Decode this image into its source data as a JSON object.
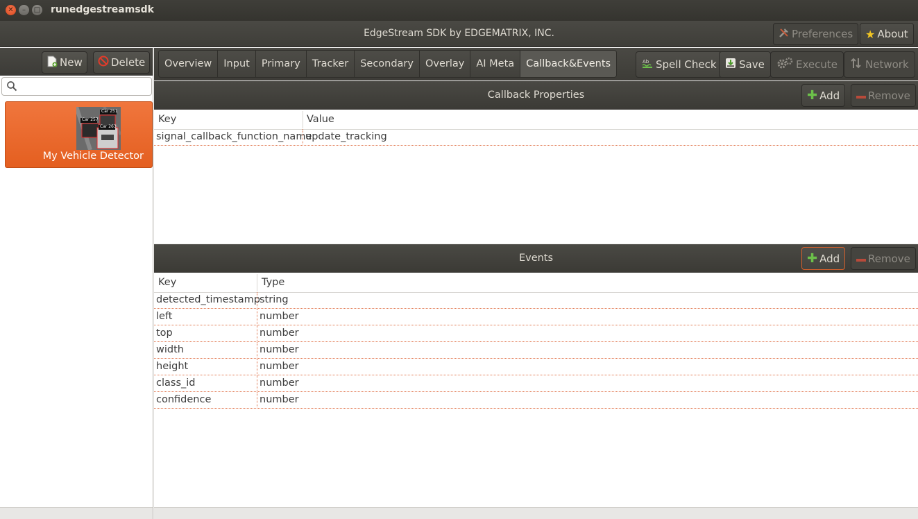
{
  "window": {
    "app_title": "runedgestreamsdk",
    "header_title": "EdgeStream SDK by EDGEMATRIX, INC.",
    "preferences_label": "Preferences",
    "about_label": "About"
  },
  "sidebar": {
    "new_label": "New",
    "delete_label": "Delete",
    "search_placeholder": "",
    "project": {
      "name": "My Vehicle Detector",
      "thumb_labels": [
        "Car 251",
        "Car 257",
        "Car 263"
      ]
    }
  },
  "tabs": [
    {
      "label": "Overview"
    },
    {
      "label": "Input"
    },
    {
      "label": "Primary"
    },
    {
      "label": "Tracker"
    },
    {
      "label": "Secondary"
    },
    {
      "label": "Overlay"
    },
    {
      "label": "AI Meta"
    },
    {
      "label": "Callback&Events",
      "active": true
    }
  ],
  "toolbar": {
    "spell_check_label": "Spell Check",
    "save_label": "Save",
    "execute_label": "Execute",
    "network_label": "Network"
  },
  "callback": {
    "title": "Callback Properties",
    "add_label": "Add",
    "remove_label": "Remove",
    "columns": [
      "Key",
      "Value"
    ],
    "rows": [
      {
        "key": "signal_callback_function_name",
        "value": "update_tracking"
      }
    ]
  },
  "events": {
    "title": "Events",
    "add_label": "Add",
    "remove_label": "Remove",
    "columns": [
      "Key",
      "Type"
    ],
    "rows": [
      {
        "key": "detected_timestamp",
        "type": "string"
      },
      {
        "key": "left",
        "type": "number"
      },
      {
        "key": "top",
        "type": "number"
      },
      {
        "key": "width",
        "type": "number"
      },
      {
        "key": "height",
        "type": "number"
      },
      {
        "key": "class_id",
        "type": "number"
      },
      {
        "key": "confidence",
        "type": "number"
      }
    ]
  },
  "colors": {
    "accent": "#e9642a",
    "dark_bar": "#3f3e39",
    "row_divider": "#e0734a"
  }
}
